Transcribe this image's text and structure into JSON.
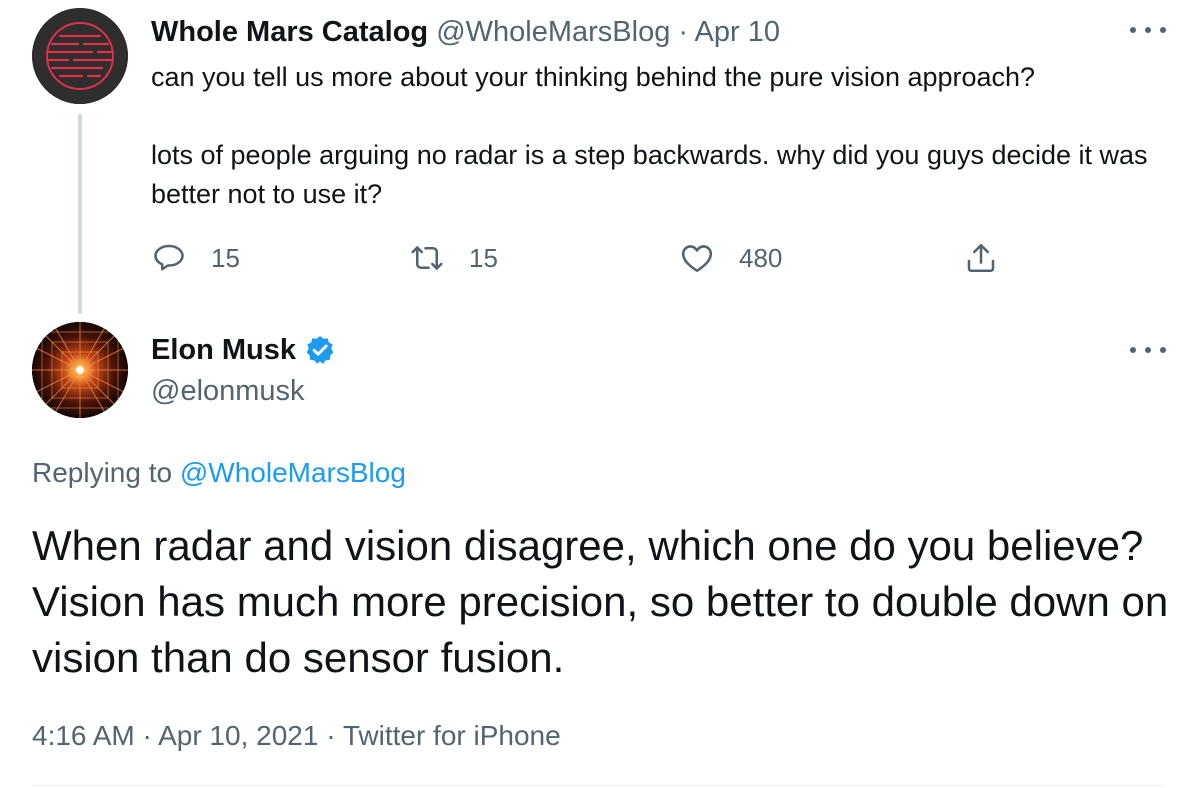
{
  "parent_tweet": {
    "author_name": "Whole Mars Catalog",
    "author_handle": "@WholeMarsBlog",
    "date": "Apr 10",
    "separator": "·",
    "text_paragraph_1": "can you tell us more about your thinking behind the pure vision approach?",
    "text_paragraph_2": "lots of people arguing no radar is a step backwards. why did you guys decide it was better not to use it?",
    "actions": {
      "reply_count": "15",
      "retweet_count": "15",
      "like_count": "480"
    }
  },
  "main_tweet": {
    "author_name": "Elon Musk",
    "author_handle": "@elonmusk",
    "replying_prefix": "Replying to",
    "replying_to": "@WholeMarsBlog",
    "text": "When radar and vision disagree, which one do you believe? Vision has much more precision, so better to double down on vision than do sensor fusion.",
    "time": "4:16 AM",
    "full_date": "Apr 10, 2021",
    "source": "Twitter for iPhone",
    "separator": "·"
  },
  "colors": {
    "text_primary": "#0f1419",
    "text_secondary": "#536471",
    "link_blue": "#1d9bf0",
    "thread_line": "#cfd9de"
  },
  "icons": [
    "reply-icon",
    "retweet-icon",
    "like-icon",
    "share-icon",
    "more-icon",
    "verified-badge-icon"
  ]
}
